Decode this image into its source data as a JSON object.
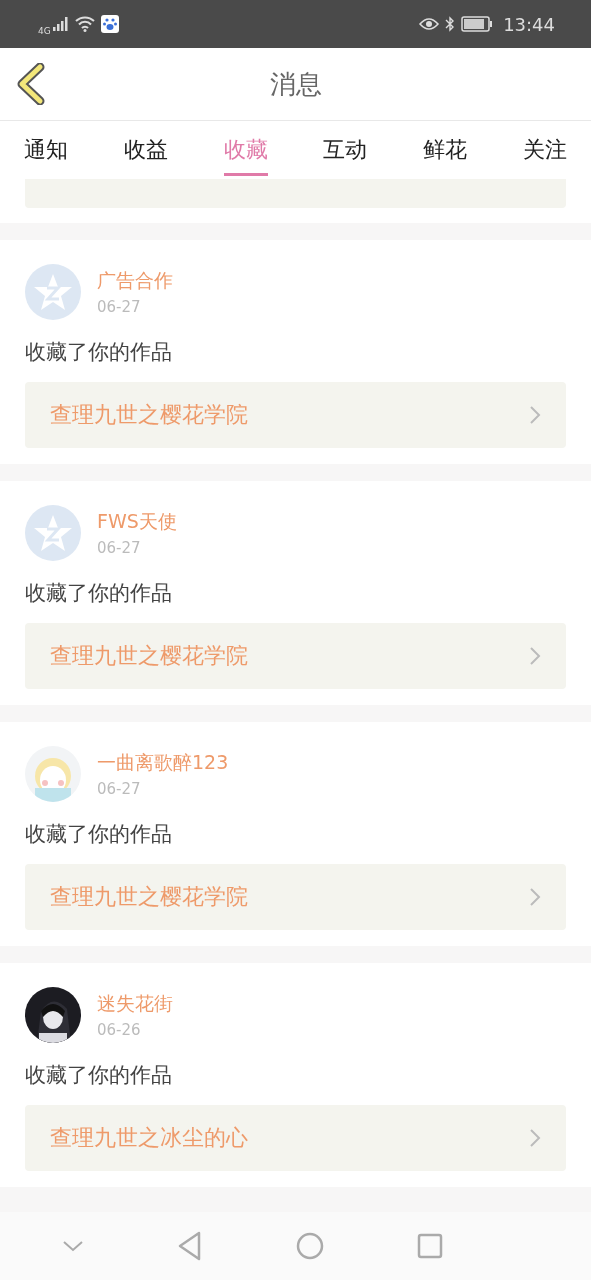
{
  "status_bar": {
    "network": "4G",
    "time": "13:44"
  },
  "header": {
    "title": "消息"
  },
  "tabs": [
    {
      "label": "通知",
      "selected": false
    },
    {
      "label": "收益",
      "selected": false
    },
    {
      "label": "收藏",
      "selected": true
    },
    {
      "label": "互动",
      "selected": false
    },
    {
      "label": "鲜花",
      "selected": false
    },
    {
      "label": "关注",
      "selected": false
    }
  ],
  "messages": [
    {
      "kind": "default",
      "name": "广告合作",
      "date": "06-27",
      "text": "收藏了你的作品",
      "work": "查理九世之樱花学院"
    },
    {
      "kind": "default",
      "name": "FWS天使",
      "date": "06-27",
      "text": "收藏了你的作品",
      "work": "查理九世之樱花学院"
    },
    {
      "kind": "picture",
      "name": "一曲离歌醉123",
      "date": "06-27",
      "text": "收藏了你的作品",
      "work": "查理九世之樱花学院"
    },
    {
      "kind": "picture",
      "name": "迷失花街",
      "date": "06-26",
      "text": "收藏了你的作品",
      "work": "查理九世之冰尘的心"
    }
  ]
}
